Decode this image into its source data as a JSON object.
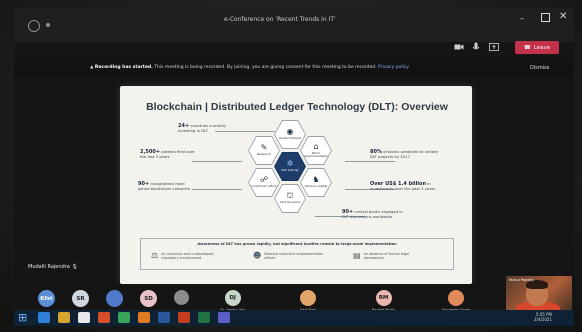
{
  "window": {
    "title": "e-Conference on 'Recent Trends in IT'",
    "minimize": "–",
    "close": "✕"
  },
  "toolbar": {
    "leave_label": "Leave",
    "icons": [
      "video-camera-icon",
      "microphone-icon",
      "share-screen-icon"
    ]
  },
  "recording_banner": {
    "bold": "Recording has started.",
    "text": " This meeting is being recorded. By joining, you are giving consent for this meeting to be recorded.",
    "link": "Privacy policy",
    "dismiss": "Dismiss"
  },
  "slide": {
    "title": "Blockchain | Distributed Ledger Technology (DLT): Overview",
    "center_label": "DLT activity",
    "hexes": [
      {
        "label": "Global interest",
        "icon": "globe-icon"
      },
      {
        "label": "Bank experimentation",
        "icon": "bank-icon"
      },
      {
        "label": "Research",
        "icon": "research-icon"
      },
      {
        "label": "Venture capital",
        "icon": "venture-capital-icon"
      },
      {
        "label": "Consortium efforts",
        "icon": "consortium-icon"
      },
      {
        "label": "Central banks",
        "icon": "central-bank-icon"
      }
    ],
    "stats": [
      {
        "bold": "24+",
        "text": "countries currently investing in DLT"
      },
      {
        "bold": "2,500+",
        "text": "patents filed over the last 3 years"
      },
      {
        "bold": "90+",
        "text": "corporations have joined blockchain consortia"
      },
      {
        "bold": "80%",
        "text": "of banks predicted to initiate DLT projects by 2017"
      },
      {
        "bold": "Over US$ 1.4 billion",
        "text": "in investments over the past 3 years"
      },
      {
        "bold": "90+",
        "text": "central banks engaged in DLT discussions worldwide"
      }
    ],
    "footer": {
      "title": "Awareness of DLT has grown rapidly, but significant hurdles remain to large-scale implementation",
      "items": [
        "An uncertain and undeveloped regulatory environment",
        "Nascent collective implementation efforts",
        "An absence of formal legal frameworks"
      ]
    }
  },
  "presenter": {
    "name": "Mudalli Rajendra"
  },
  "participants": [
    {
      "initials": "Kfst",
      "name": "",
      "color": "#5b8fd6"
    },
    {
      "initials": "SR",
      "name": "",
      "color": "#cfd6dd"
    },
    {
      "initials": "",
      "name": "",
      "color": "#4f79c9"
    },
    {
      "initials": "SD",
      "name": "",
      "color": "#e7c3c9"
    },
    {
      "initials": "",
      "name": "",
      "color": "#8c8c8c"
    },
    {
      "initials": "DJ",
      "name": "Dr. Amala Jain",
      "color": "#c9d7c9"
    },
    {
      "initials": "",
      "name": "Sarli Rao",
      "color": "#e0a56b"
    },
    {
      "initials": "RM",
      "name": "Ranbel Mulla",
      "color": "#e9b6b0"
    },
    {
      "initials": "",
      "name": "Sangeeta Sagar",
      "color": "#e08a5a"
    }
  ],
  "video": {
    "name": "Mukul Pandey"
  },
  "taskbar": {
    "time": "5:05 PM",
    "date": "2/4/2021",
    "apps": [
      "edge-icon",
      "folder-icon",
      "media-player-icon",
      "store-icon",
      "chrome-icon",
      "firefox-icon",
      "word-icon",
      "powerpoint-icon",
      "excel-icon",
      "teams-icon"
    ]
  }
}
